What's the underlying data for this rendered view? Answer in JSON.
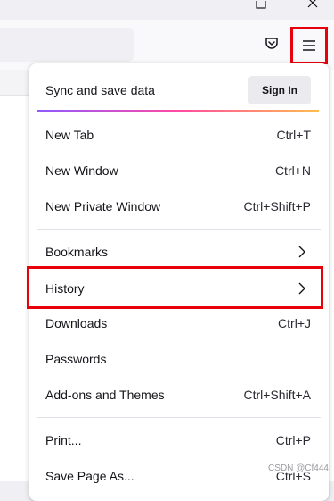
{
  "window": {
    "maximize_icon": "maximize-icon",
    "close_icon": "close-icon"
  },
  "toolbar": {
    "pocket_icon": "pocket-icon",
    "menu_icon": "hamburger-menu-icon",
    "highlight_color": "#e8000b"
  },
  "panel": {
    "sync_label": "Sync and save data",
    "sign_in_label": "Sign In",
    "items_group1": [
      {
        "label": "New Tab",
        "shortcut": "Ctrl+T"
      },
      {
        "label": "New Window",
        "shortcut": "Ctrl+N"
      },
      {
        "label": "New Private Window",
        "shortcut": "Ctrl+Shift+P"
      }
    ],
    "items_group2": [
      {
        "label": "Bookmarks",
        "shortcut": ""
      },
      {
        "label": "History",
        "shortcut": ""
      },
      {
        "label": "Downloads",
        "shortcut": "Ctrl+J"
      },
      {
        "label": "Passwords",
        "shortcut": ""
      },
      {
        "label": "Add-ons and Themes",
        "shortcut": "Ctrl+Shift+A"
      }
    ],
    "items_group3": [
      {
        "label": "Print...",
        "shortcut": "Ctrl+P"
      },
      {
        "label": "Save Page As...",
        "shortcut": "Ctrl+S"
      }
    ]
  },
  "watermark": "CSDN @Cf444"
}
